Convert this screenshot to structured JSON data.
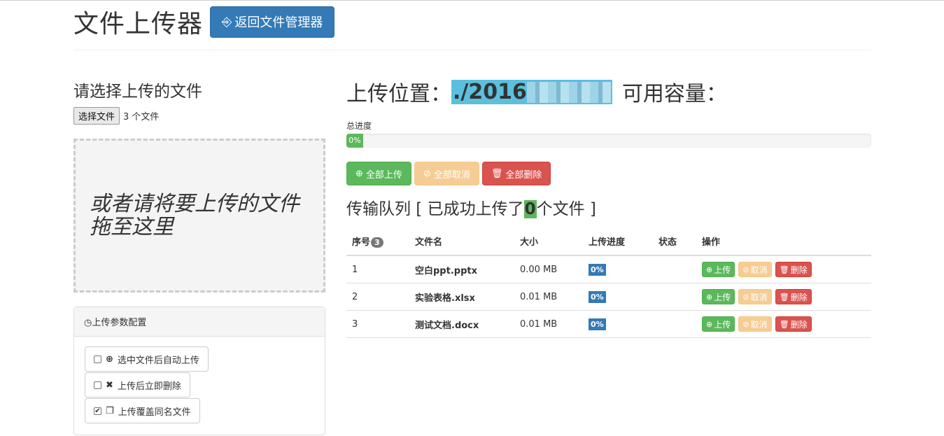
{
  "header": {
    "title": "文件上传器",
    "back_button": "返回文件管理器"
  },
  "left": {
    "select_title": "请选择上传的文件",
    "file_button": "选择文件",
    "file_count": "3 个文件",
    "dropzone_text": "或者请将要上传的文件拖至这里",
    "config": {
      "title": "上传参数配置",
      "options": [
        {
          "label": "选中文件后自动上传",
          "checked": false,
          "icon": "upload-circle-icon"
        },
        {
          "label": "上传后立即删除",
          "checked": false,
          "icon": "remove-x-icon"
        },
        {
          "label": "上传覆盖同名文件",
          "checked": true,
          "icon": "copy-files-icon"
        }
      ]
    }
  },
  "right": {
    "location_label": "上传位置：",
    "location_path": "./2016",
    "capacity_label": "可用容量：",
    "total_progress_label": "总进度",
    "total_progress": 0,
    "total_progress_text": "0%",
    "bulk": {
      "upload_all": "全部上传",
      "cancel_all": "全部取消",
      "delete_all": "全部删除"
    },
    "queue": {
      "prefix": "传输队列 [ 已成功上传了",
      "count": "0",
      "suffix": "个文件 ]"
    },
    "table": {
      "headers": {
        "index": "序号",
        "count_badge": "3",
        "name": "文件名",
        "size": "大小",
        "progress": "上传进度",
        "status": "状态",
        "ops": "操作"
      },
      "rows": [
        {
          "index": "1",
          "name": "空白ppt.pptx",
          "size": "0.00 MB",
          "progress": "0%",
          "status": ""
        },
        {
          "index": "2",
          "name": "实验表格.xlsx",
          "size": "0.01 MB",
          "progress": "0%",
          "status": ""
        },
        {
          "index": "3",
          "name": "测试文档.docx",
          "size": "0.01 MB",
          "progress": "0%",
          "status": ""
        }
      ],
      "row_buttons": {
        "upload": "上传",
        "cancel": "取消",
        "delete": "删除"
      }
    }
  },
  "colors": {
    "primary": "#337ab7",
    "success": "#5cb85c",
    "warning": "#f0ad4e",
    "danger": "#d9534f",
    "info": "#5bc0de"
  }
}
